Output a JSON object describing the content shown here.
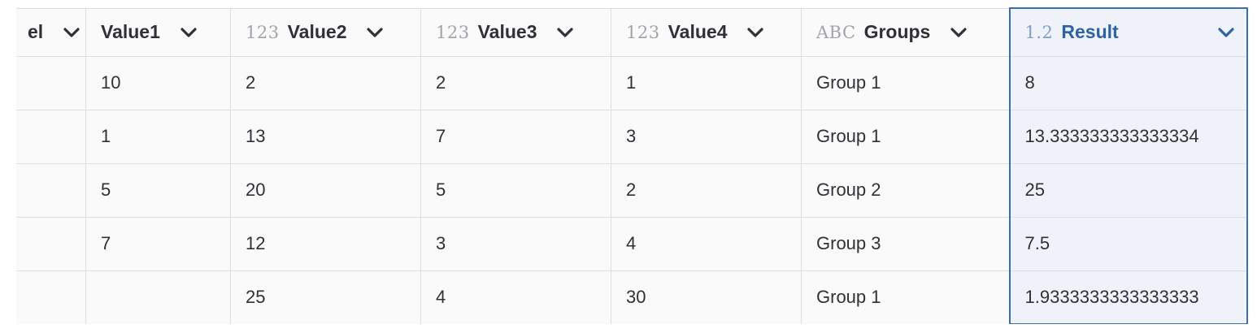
{
  "columns": [
    {
      "id": "label",
      "type_badge": "",
      "label": "el"
    },
    {
      "id": "value1",
      "type_badge": "",
      "label": "Value1"
    },
    {
      "id": "value2",
      "type_badge": "123",
      "label": "Value2"
    },
    {
      "id": "value3",
      "type_badge": "123",
      "label": "Value3"
    },
    {
      "id": "value4",
      "type_badge": "123",
      "label": "Value4"
    },
    {
      "id": "groups",
      "type_badge": "ABC",
      "label": "Groups"
    },
    {
      "id": "result",
      "type_badge": "1.2",
      "label": "Result"
    }
  ],
  "rows": [
    {
      "label": "",
      "value1": "10",
      "value2": "2",
      "value3": "2",
      "value4": "1",
      "groups": "Group 1",
      "result": "8"
    },
    {
      "label": "",
      "value1": "1",
      "value2": "13",
      "value3": "7",
      "value4": "3",
      "groups": "Group 1",
      "result": "13.333333333333334"
    },
    {
      "label": "",
      "value1": "5",
      "value2": "20",
      "value3": "5",
      "value4": "2",
      "groups": "Group 2",
      "result": "25"
    },
    {
      "label": "",
      "value1": "7",
      "value2": "12",
      "value3": "3",
      "value4": "4",
      "groups": "Group 3",
      "result": "7.5"
    },
    {
      "label": "",
      "value1": "",
      "value2": "25",
      "value3": "4",
      "value4": "30",
      "groups": "Group 1",
      "result": "1.9333333333333333"
    }
  ],
  "selected_column": "result",
  "colors": {
    "selected_accent": "#3c6ea7",
    "selected_bg": "#eff2f8",
    "grid_line": "#dedfe3",
    "text": "#2f3136",
    "type_badge": "#a2a4aa"
  },
  "icons": {
    "column_menu": "chevron-down-icon"
  }
}
